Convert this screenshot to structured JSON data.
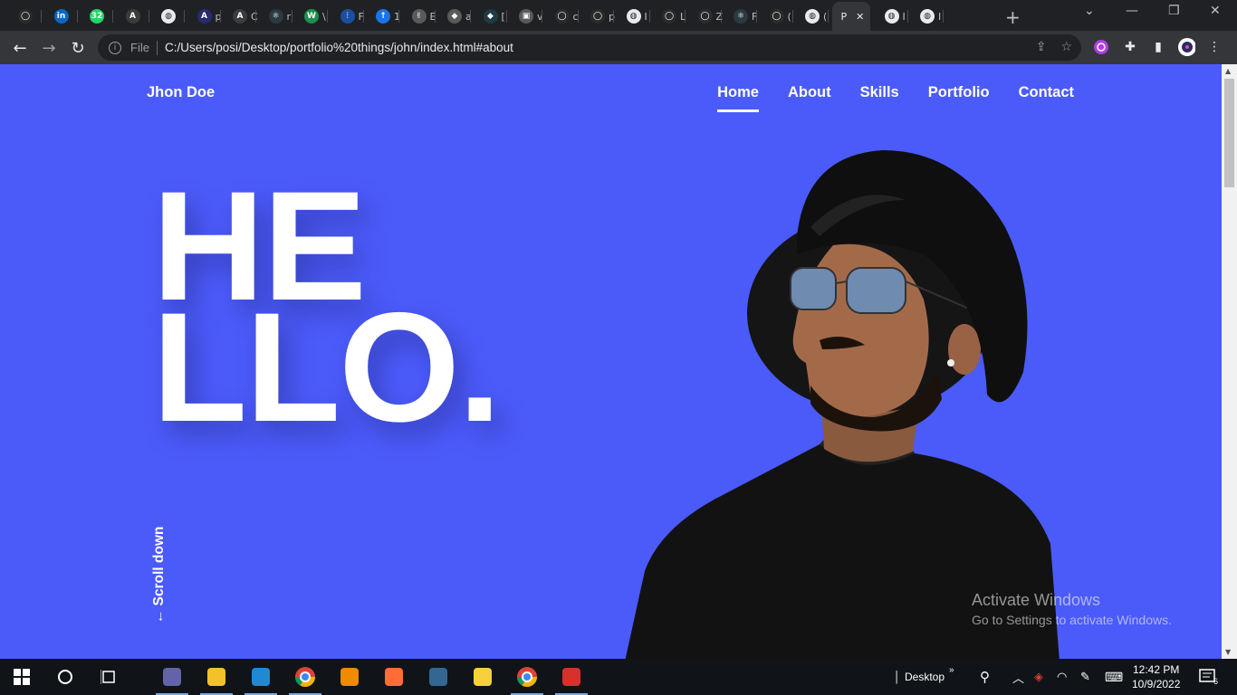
{
  "browser": {
    "tabs": [
      {
        "icon": "github-icon",
        "color": "#2b2b2b",
        "glyph": "◯",
        "title": ""
      },
      {
        "icon": "linkedin-icon",
        "color": "#0a66c2",
        "glyph": "in",
        "title": ""
      },
      {
        "icon": "whatsapp-icon",
        "color": "#25d366",
        "glyph": "32",
        "title": ""
      },
      {
        "icon": "a-logo-icon",
        "color": "#3c3c3c",
        "glyph": "A",
        "title": ""
      },
      {
        "icon": "globe-icon",
        "color": "#e8eaed",
        "glyph": "◍",
        "title": ""
      },
      {
        "icon": "a-logo-icon",
        "color": "#2a2a6e",
        "glyph": "A",
        "title": "p"
      },
      {
        "icon": "a-logo-icon",
        "color": "#3c3c3c",
        "glyph": "A",
        "title": "C"
      },
      {
        "icon": "react-icon",
        "color": "#2b3a42",
        "glyph": "⚛",
        "title": "r"
      },
      {
        "icon": "w-logo-icon",
        "color": "#1d8f4e",
        "glyph": "W",
        "title": "\\"
      },
      {
        "icon": "blue-logo-icon",
        "color": "#1a4fa0",
        "glyph": "⫶",
        "title": "F"
      },
      {
        "icon": "blue-logo-icon",
        "color": "#1a73e8",
        "glyph": "↑",
        "title": "1"
      },
      {
        "icon": "hand-icon",
        "color": "#5a5a5a",
        "glyph": "✌",
        "title": "E"
      },
      {
        "icon": "diamond-icon",
        "color": "#5a5a5a",
        "glyph": "◆",
        "title": "a"
      },
      {
        "icon": "diamond-icon",
        "color": "#1f3a44",
        "glyph": "◆",
        "title": "["
      },
      {
        "icon": "image-icon",
        "color": "#5a5a5a",
        "glyph": "▣",
        "title": "v"
      },
      {
        "icon": "github-icon",
        "color": "#2b2b2b",
        "glyph": "◯",
        "title": "c"
      },
      {
        "icon": "github-icon",
        "color": "#2b2b2b",
        "glyph": "◯",
        "title": "p"
      },
      {
        "icon": "globe-icon",
        "color": "#e8eaed",
        "glyph": "◍",
        "title": "I"
      },
      {
        "icon": "github-icon",
        "color": "#2b2b2b",
        "glyph": "◯",
        "title": "L"
      },
      {
        "icon": "github-icon",
        "color": "#2b2b2b",
        "glyph": "◯",
        "title": "Z"
      },
      {
        "icon": "react-icon",
        "color": "#2b3a42",
        "glyph": "⚛",
        "title": "F"
      },
      {
        "icon": "github-icon",
        "color": "#2b2b2b",
        "glyph": "◯",
        "title": "("
      },
      {
        "icon": "globe-icon",
        "color": "#e8eaed",
        "glyph": "◍",
        "title": "("
      },
      {
        "icon": "",
        "color": "",
        "glyph": "",
        "title": "P",
        "active": true
      },
      {
        "icon": "globe-icon",
        "color": "#e8eaed",
        "glyph": "◍",
        "title": "I"
      },
      {
        "icon": "globe-icon",
        "color": "#e8eaed",
        "glyph": "◍",
        "title": "I"
      }
    ],
    "new_tab": "+",
    "address": {
      "scheme": "File",
      "url": "C:/Users/posi/Desktop/portfolio%20things/john/index.html#about"
    }
  },
  "page": {
    "logo": "Jhon Doe",
    "nav": [
      {
        "label": "Home",
        "active": true
      },
      {
        "label": "About",
        "active": false
      },
      {
        "label": "Skills",
        "active": false
      },
      {
        "label": "Portfolio",
        "active": false
      },
      {
        "label": "Contact",
        "active": false
      }
    ],
    "hero": {
      "line1": "HE",
      "line2": "LLO."
    },
    "scroll_down": "Scroll down",
    "background_color": "#4b5bfa"
  },
  "watermark": {
    "title": "Activate Windows",
    "subtitle": "Go to Settings to activate Windows."
  },
  "taskbar": {
    "apps": [
      "teams-icon",
      "file-explorer-icon",
      "vscode-icon",
      "chrome-icon",
      "vlc-icon",
      "postman-icon",
      "postgres-icon",
      "sticky-notes-icon",
      "chrome-profile-icon",
      "wps-icon"
    ],
    "desktop_label": "Desktop",
    "time": "12:42 PM",
    "date": "10/9/2022",
    "notifications": "6"
  }
}
